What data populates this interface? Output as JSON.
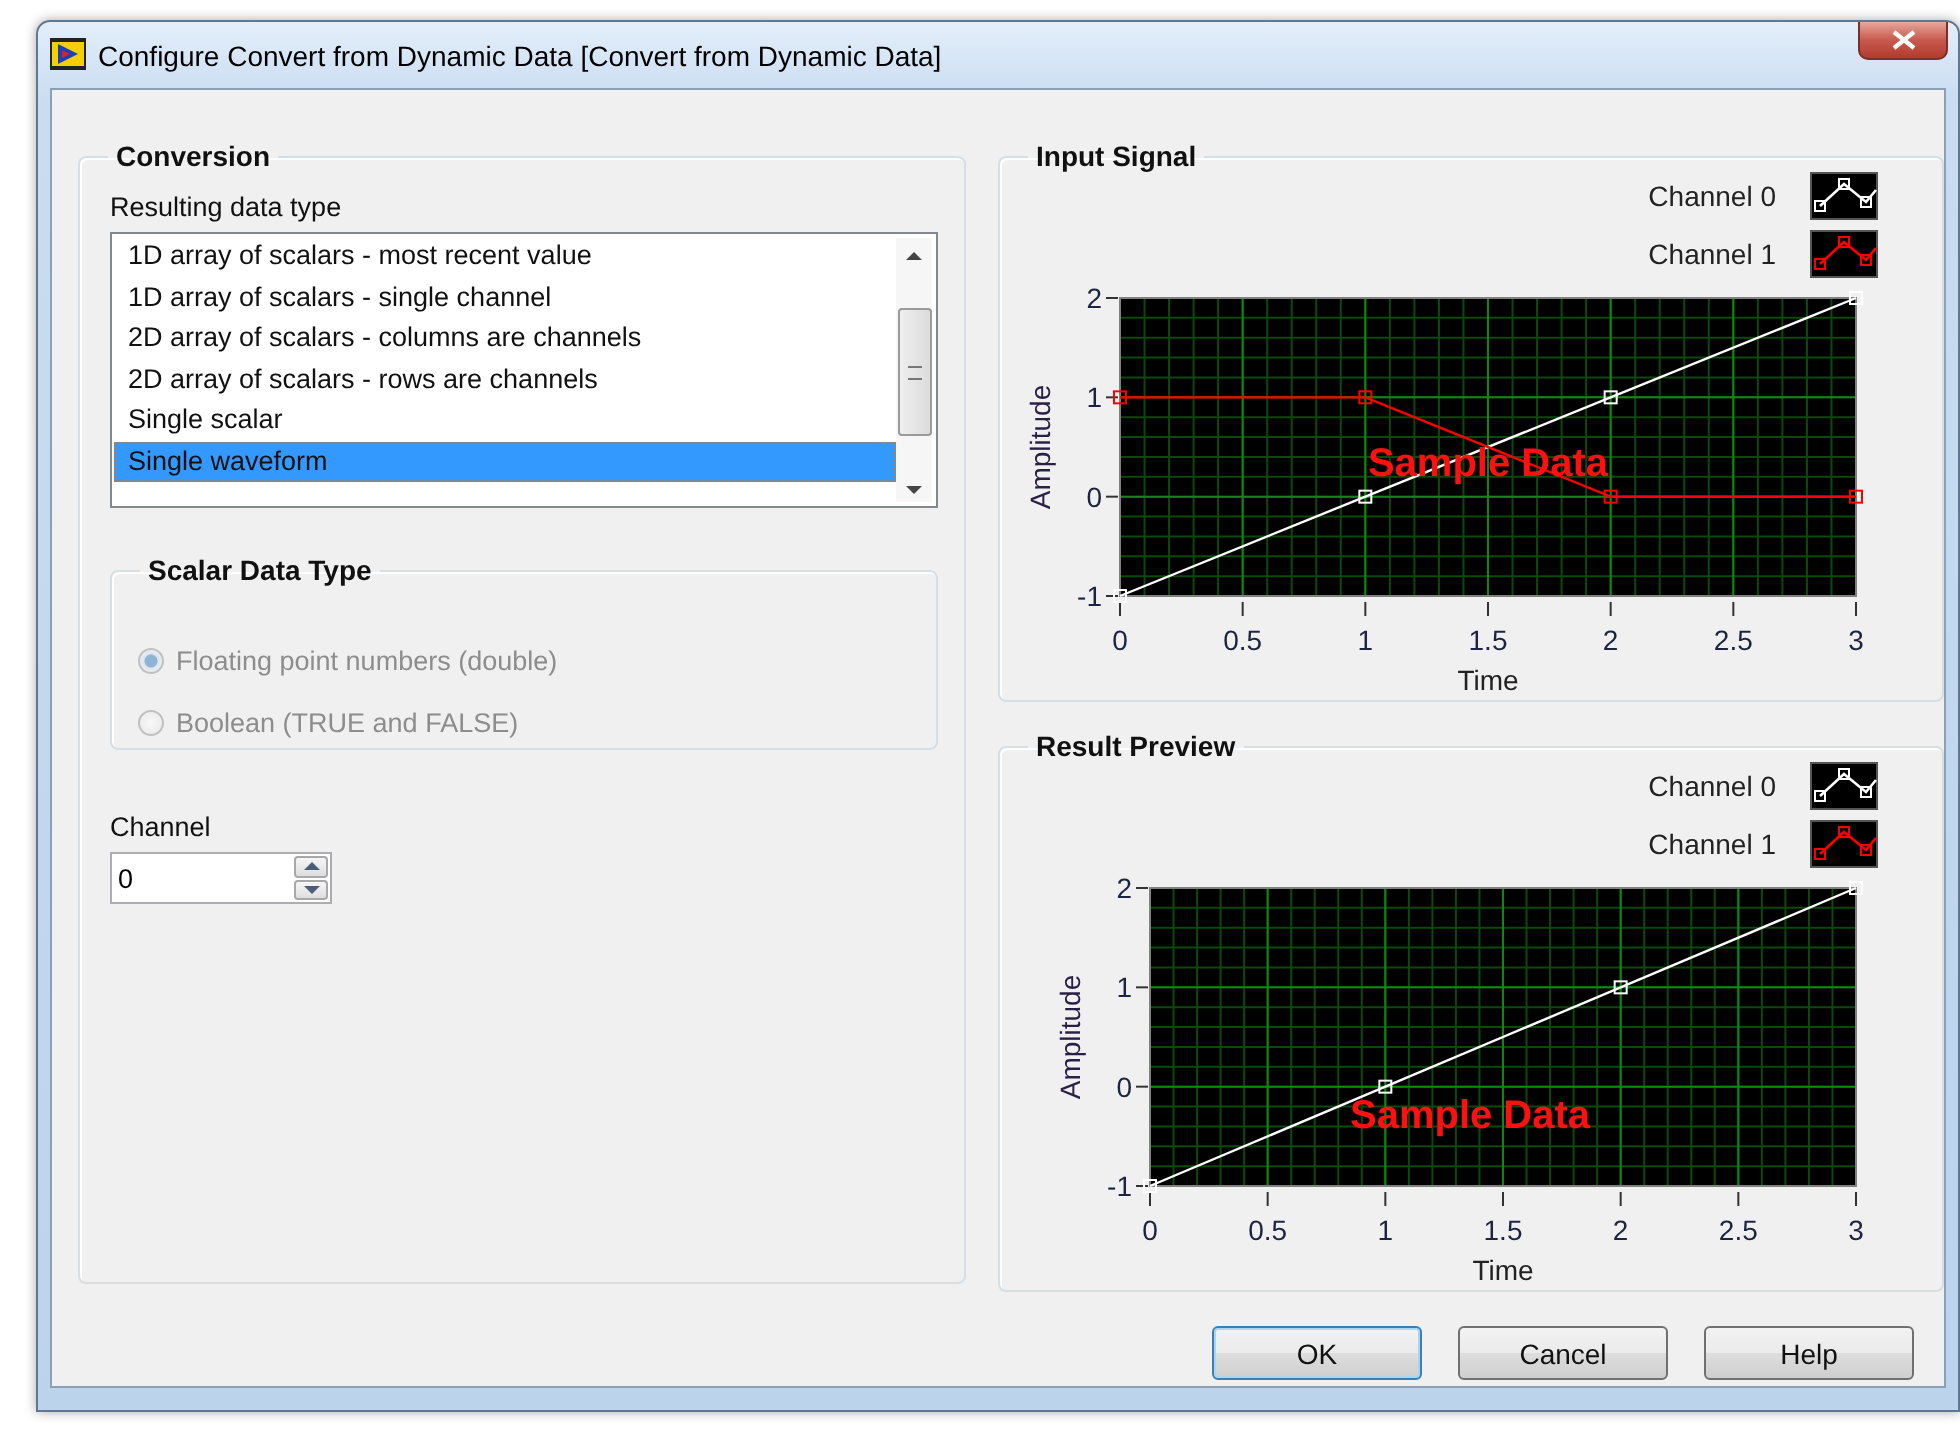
{
  "window": {
    "title": "Configure Convert from Dynamic Data [Convert from Dynamic Data]"
  },
  "conversion": {
    "title": "Conversion",
    "list_label": "Resulting data type",
    "result_types": [
      {
        "label": "1D array of scalars - most recent value",
        "selected": false
      },
      {
        "label": "1D array of scalars - single channel",
        "selected": false
      },
      {
        "label": "2D array of scalars - columns are channels",
        "selected": false
      },
      {
        "label": "2D array of scalars - rows are channels",
        "selected": false
      },
      {
        "label": "Single scalar",
        "selected": false
      },
      {
        "label": "Single waveform",
        "selected": true
      }
    ],
    "scalar_data_type": {
      "title": "Scalar Data Type",
      "options": [
        {
          "label": "Floating point numbers (double)",
          "selected": true,
          "disabled": true
        },
        {
          "label": "Boolean (TRUE and FALSE)",
          "selected": false,
          "disabled": true
        }
      ]
    },
    "channel": {
      "label": "Channel",
      "value": "0"
    }
  },
  "input_signal": {
    "title": "Input Signal",
    "chart_data": {
      "type": "line",
      "xlabel": "Time",
      "ylabel": "Amplitude",
      "x": [
        0,
        1,
        2,
        3
      ],
      "series": [
        {
          "name": "Channel 0",
          "color": "#ffffff",
          "values": [
            -1,
            0,
            1,
            2
          ],
          "marker": "square"
        },
        {
          "name": "Channel 1",
          "color": "#ff0000",
          "values": [
            1,
            1,
            0,
            0
          ],
          "marker": "square"
        }
      ],
      "xlim": [
        0,
        3
      ],
      "ylim": [
        -1,
        2
      ],
      "xticks": [
        0,
        0.5,
        1,
        1.5,
        2,
        2.5,
        3
      ],
      "yticks": [
        -1,
        0,
        1,
        2
      ],
      "grid": true,
      "annotations": [
        "Sample Data"
      ]
    }
  },
  "result_preview": {
    "title": "Result Preview",
    "chart_data": {
      "type": "line",
      "xlabel": "Time",
      "ylabel": "Amplitude",
      "x": [
        0,
        1,
        2,
        3
      ],
      "series": [
        {
          "name": "Channel 0",
          "color": "#ffffff",
          "values": [
            -1,
            0,
            1,
            2
          ],
          "marker": "square"
        },
        {
          "name": "Channel 1",
          "color": "#ff0000",
          "values": [
            null,
            null,
            null,
            null
          ],
          "marker": "square"
        }
      ],
      "xlim": [
        0,
        3
      ],
      "ylim": [
        -1,
        2
      ],
      "xticks": [
        0,
        0.5,
        1,
        1.5,
        2,
        2.5,
        3
      ],
      "yticks": [
        -1,
        0,
        1,
        2
      ],
      "grid": true,
      "annotations": [
        "Sample Data"
      ]
    }
  },
  "buttons": [
    {
      "label": "OK",
      "default": true
    },
    {
      "label": "Cancel",
      "default": false
    },
    {
      "label": "Help",
      "default": false
    }
  ]
}
